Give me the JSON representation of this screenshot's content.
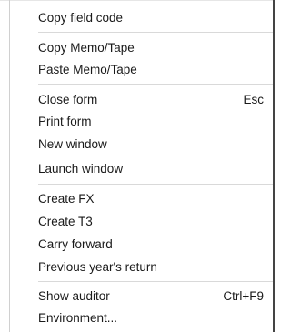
{
  "menu": {
    "items": [
      {
        "label": "Copy field code",
        "shortcut": ""
      },
      {
        "label": "Copy Memo/Tape",
        "shortcut": ""
      },
      {
        "label": "Paste Memo/Tape",
        "shortcut": ""
      },
      {
        "label": "Close form",
        "shortcut": "Esc"
      },
      {
        "label": "Print form",
        "shortcut": ""
      },
      {
        "label": "New window",
        "shortcut": ""
      },
      {
        "label": "Launch window",
        "shortcut": ""
      },
      {
        "label": "Create FX",
        "shortcut": ""
      },
      {
        "label": "Create T3",
        "shortcut": ""
      },
      {
        "label": "Carry forward",
        "shortcut": ""
      },
      {
        "label": "Previous year's return",
        "shortcut": ""
      },
      {
        "label": "Show auditor",
        "shortcut": "Ctrl+F9"
      },
      {
        "label": "Environment...",
        "shortcut": ""
      }
    ]
  }
}
